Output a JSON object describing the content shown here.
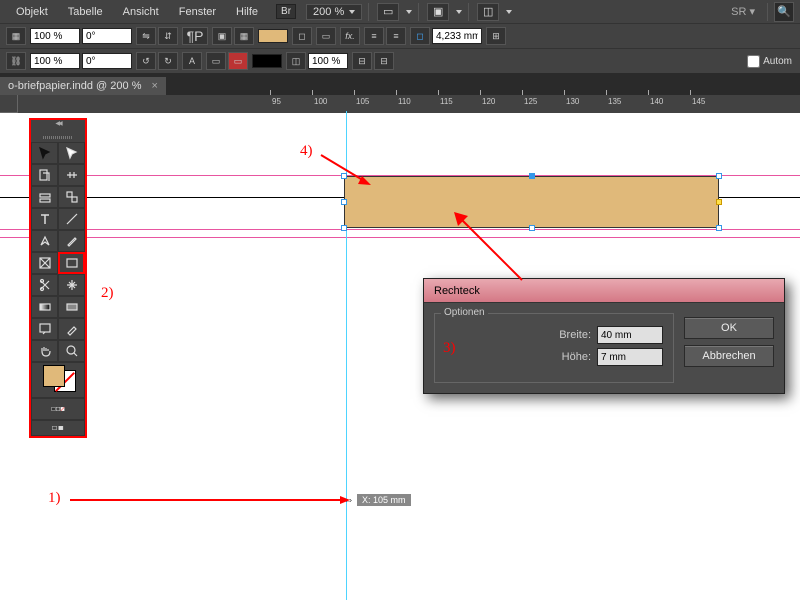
{
  "menu": {
    "items": [
      "Objekt",
      "Tabelle",
      "Ansicht",
      "Fenster",
      "Hilfe"
    ],
    "br": "Br",
    "zoom": "200 %",
    "sr": "SR"
  },
  "toolbar": {
    "pct1": "100 %",
    "pct2": "100 %",
    "deg1": "0°",
    "deg2": "0°",
    "dim": "4,233 mm",
    "autom": "Autom"
  },
  "tab": {
    "title": "o-briefpapier.indd @ 200 %"
  },
  "ruler": {
    "marks": [
      "95",
      "100",
      "105",
      "110",
      "115",
      "120",
      "125",
      "130",
      "135",
      "140",
      "145"
    ]
  },
  "dialog": {
    "title": "Rechteck",
    "legend": "Optionen",
    "width_label": "Breite:",
    "width_val": "40 mm",
    "height_label": "Höhe:",
    "height_val": "7 mm",
    "ok": "OK",
    "cancel": "Abbrechen"
  },
  "xbadge": {
    "text": "X: 105 mm"
  },
  "annot": {
    "n1": "1)",
    "n2": "2)",
    "n3": "3)",
    "n4": "4)"
  }
}
